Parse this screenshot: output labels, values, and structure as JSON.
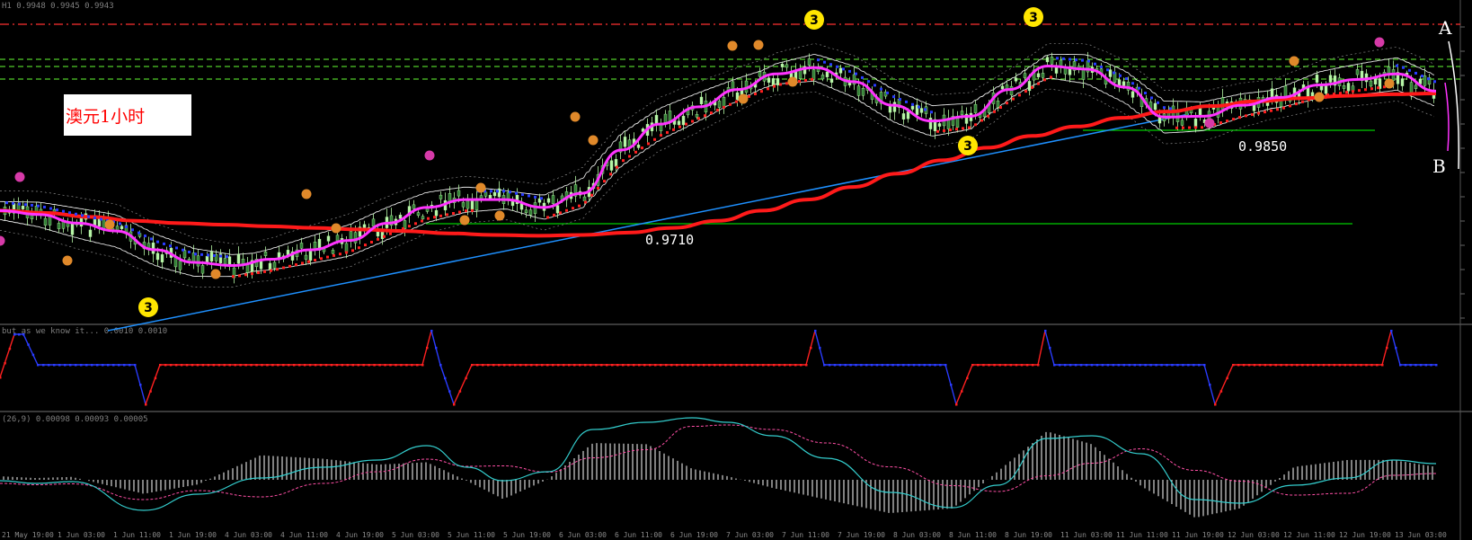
{
  "header": {
    "price_label": "H1  0.9948 0.9945 0.9943",
    "sub1_label": "but as we know it... 0.0010 0.0010",
    "sub2_label": "(26,9) 0.00098 0.00093 0.00005"
  },
  "title_box": "澳元1小时",
  "annotations": {
    "level_1": "0.9710",
    "level_2": "0.9850",
    "corner_a": "A",
    "corner_b": "B"
  },
  "wave_markers": [
    "3",
    "3",
    "3",
    "3"
  ],
  "time_axis": [
    "21 May 19:00",
    "1 Jun 03:00",
    "1 Jun 11:00",
    "1 Jun 19:00",
    "4 Jun 03:00",
    "4 Jun 11:00",
    "4 Jun 19:00",
    "5 Jun 03:00",
    "5 Jun 11:00",
    "5 Jun 19:00",
    "6 Jun 03:00",
    "6 Jun 11:00",
    "6 Jun 19:00",
    "7 Jun 03:00",
    "7 Jun 11:00",
    "7 Jun 19:00",
    "8 Jun 03:00",
    "8 Jun 11:00",
    "8 Jun 19:00",
    "11 Jun 03:00",
    "11 Jun 11:00",
    "11 Jun 19:00",
    "12 Jun 03:00",
    "12 Jun 11:00",
    "12 Jun 19:00",
    "13 Jun 03:00"
  ],
  "colors": {
    "bg": "#000000",
    "candle_bull": "#b6f5a6",
    "candle_bear": "#2e7d32",
    "red_ma": "#ff1a1a",
    "magenta_ma": "#ff33ff",
    "trendline": "#1e90ff",
    "level_line": "#00cc00",
    "envelope": "#ffffff",
    "osc_red": "#ff2020",
    "osc_blue": "#2a3cff",
    "macd_signal": "#ff4fa6",
    "macd_main": "#33cccc",
    "marker_yellow": "#ffe600",
    "marker_orange": "#e0892a",
    "marker_pink": "#d63aa8"
  },
  "chart_data": {
    "type": "line",
    "title": "澳元1小时",
    "xlabel": "",
    "ylabel": "",
    "ylim": [
      0.96,
      0.999
    ],
    "horizontal_levels": [
      0.971,
      0.985
    ],
    "series": [
      {
        "values": [
          0.9738,
          0.9735,
          0.973,
          0.9725,
          0.9722,
          0.972,
          0.9718,
          0.9716,
          0.9714,
          0.9712,
          0.9709,
          0.9707,
          0.9706,
          0.9707,
          0.971,
          0.9716,
          0.9725,
          0.9738,
          0.9752,
          0.9768,
          0.9785,
          0.9802,
          0.9818,
          0.9833,
          0.9845,
          0.9856,
          0.9864,
          0.9871,
          0.9877,
          0.9881,
          0.9884,
          0.9886,
          0.9887
        ]
      },
      {
        "values": [
          0.9738,
          0.9733,
          0.9722,
          0.9712,
          0.9688,
          0.9672,
          0.9668,
          0.9676,
          0.9688,
          0.97,
          0.9722,
          0.9742,
          0.9752,
          0.9752,
          0.9742,
          0.976,
          0.9815,
          0.9848,
          0.987,
          0.9892,
          0.9912,
          0.992,
          0.9902,
          0.9872,
          0.9852,
          0.9858,
          0.9892,
          0.9922,
          0.9918,
          0.9895,
          0.9857,
          0.9858,
          0.9872,
          0.9882,
          0.9898,
          0.9905,
          0.9912,
          0.989
        ]
      }
    ]
  }
}
